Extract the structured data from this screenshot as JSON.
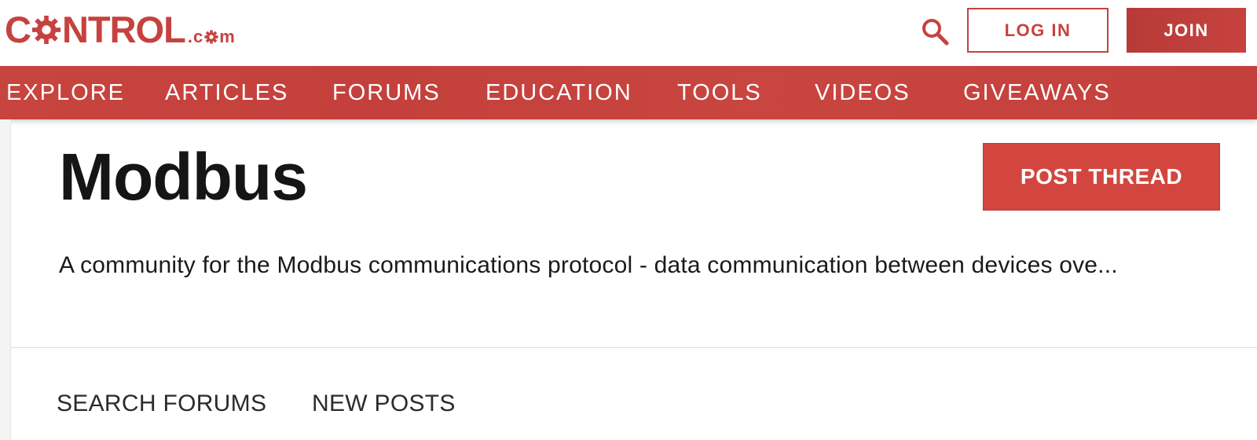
{
  "header": {
    "logo": {
      "main_prefix": "C",
      "main_suffix": "NTROL",
      "dot_text": ".c",
      "dot_suffix": "m"
    },
    "login_label": "LOG IN",
    "join_label": "JOIN",
    "search_icon": "search-icon"
  },
  "nav": {
    "items": [
      {
        "label": "EXPLORE"
      },
      {
        "label": "ARTICLES"
      },
      {
        "label": "FORUMS"
      },
      {
        "label": "EDUCATION"
      },
      {
        "label": "TOOLS"
      },
      {
        "label": "VIDEOS"
      },
      {
        "label": "GIVEAWAYS"
      }
    ]
  },
  "forum": {
    "title": "Modbus",
    "post_thread_label": "POST THREAD",
    "description": "A community for the Modbus communications protocol - data communication between devices ove..."
  },
  "sub_nav": {
    "items": [
      {
        "label": "SEARCH FORUMS"
      },
      {
        "label": "NEW POSTS"
      }
    ]
  },
  "colors": {
    "brand_red": "#c6423f",
    "button_red": "#d2463f",
    "text_dark": "#151515"
  }
}
